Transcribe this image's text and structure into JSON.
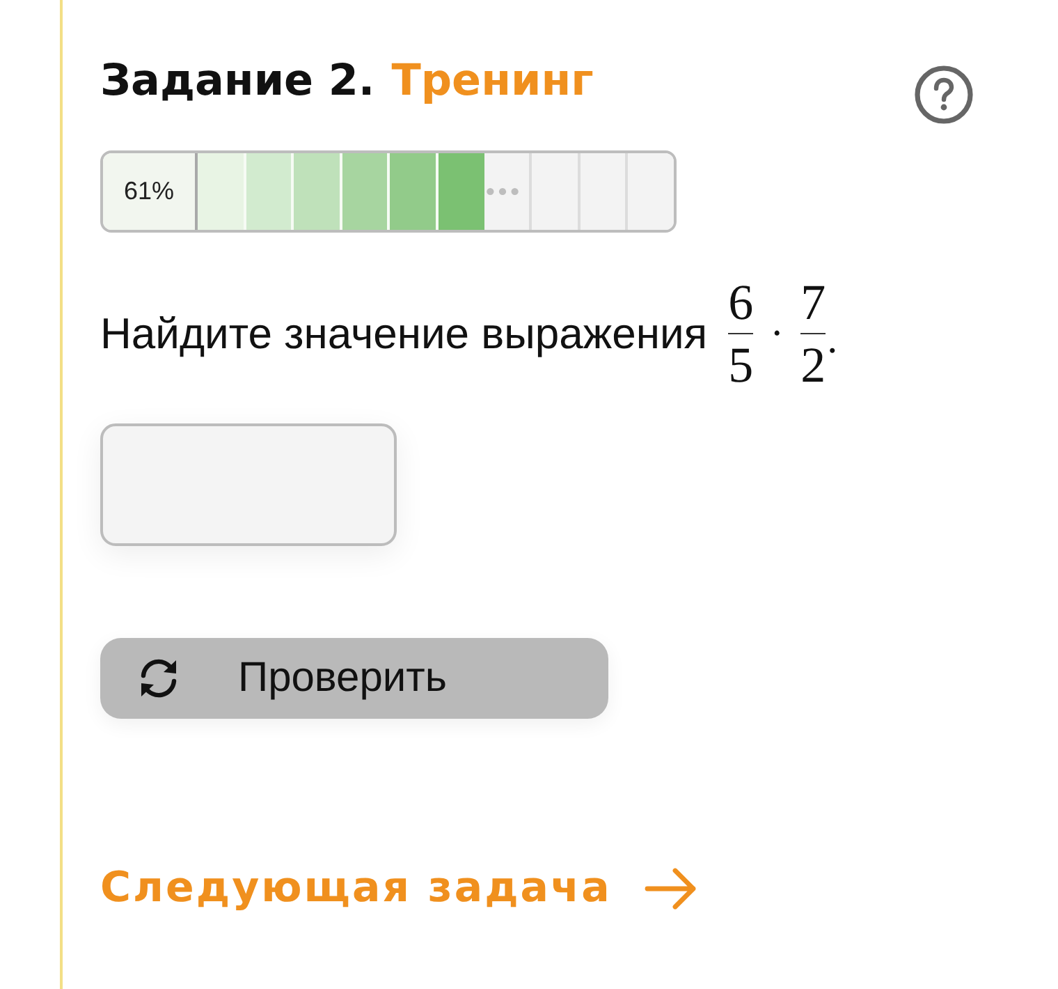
{
  "header": {
    "title": "Задание 2.",
    "mode": "Тренинг"
  },
  "progress": {
    "percent": "61%",
    "segments": [
      {
        "kind": "filled",
        "color": "#e8f4e4"
      },
      {
        "kind": "filled",
        "color": "#d2ebcf"
      },
      {
        "kind": "filled",
        "color": "#bfe1ba"
      },
      {
        "kind": "filled",
        "color": "#a7d5a0"
      },
      {
        "kind": "filled",
        "color": "#92cb8a"
      },
      {
        "kind": "filled",
        "color": "#7bc172"
      },
      {
        "kind": "more"
      },
      {
        "kind": "empty"
      },
      {
        "kind": "empty"
      },
      {
        "kind": "empty"
      }
    ]
  },
  "question": {
    "text": "Найдите значение выражения",
    "expression": [
      {
        "kind": "fraction",
        "numerator": "6",
        "denominator": "5"
      },
      {
        "kind": "operator",
        "symbol": "·"
      },
      {
        "kind": "fraction",
        "numerator": "7",
        "denominator": "2"
      },
      {
        "kind": "punct",
        "symbol": "."
      }
    ]
  },
  "check_button": {
    "label": "Проверить",
    "disabled": true
  },
  "next_link": {
    "label": "Следующая задача"
  }
}
